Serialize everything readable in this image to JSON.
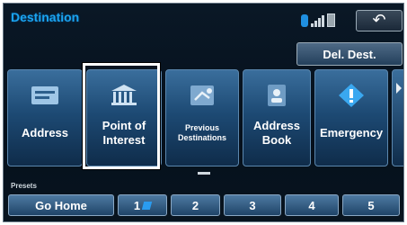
{
  "header": {
    "title": "Destination",
    "back_glyph": "↶",
    "delete_destinations_label": "Del. Dest."
  },
  "menu": {
    "items": [
      {
        "label": "Address",
        "icon": "address-card-icon"
      },
      {
        "label": "Point of Interest",
        "icon": "building-columns-icon"
      },
      {
        "label": "Previous Destinations",
        "icon": "previous-destinations-icon"
      },
      {
        "label": "Address Book",
        "icon": "address-book-icon"
      },
      {
        "label": "Emergency",
        "icon": "emergency-diamond-icon"
      }
    ],
    "more_icon": "chevron-right-icon"
  },
  "presets": {
    "label": "Presets",
    "buttons": [
      {
        "label": "Go Home"
      },
      {
        "label": "1"
      },
      {
        "label": "2"
      },
      {
        "label": "3"
      },
      {
        "label": "4"
      },
      {
        "label": "5"
      }
    ]
  },
  "colors": {
    "title_blue": "#1aa4f0",
    "tile_top": "#3a6e9c",
    "tile_bottom": "#0f2c4a",
    "highlight_frame": "#ffffff"
  }
}
